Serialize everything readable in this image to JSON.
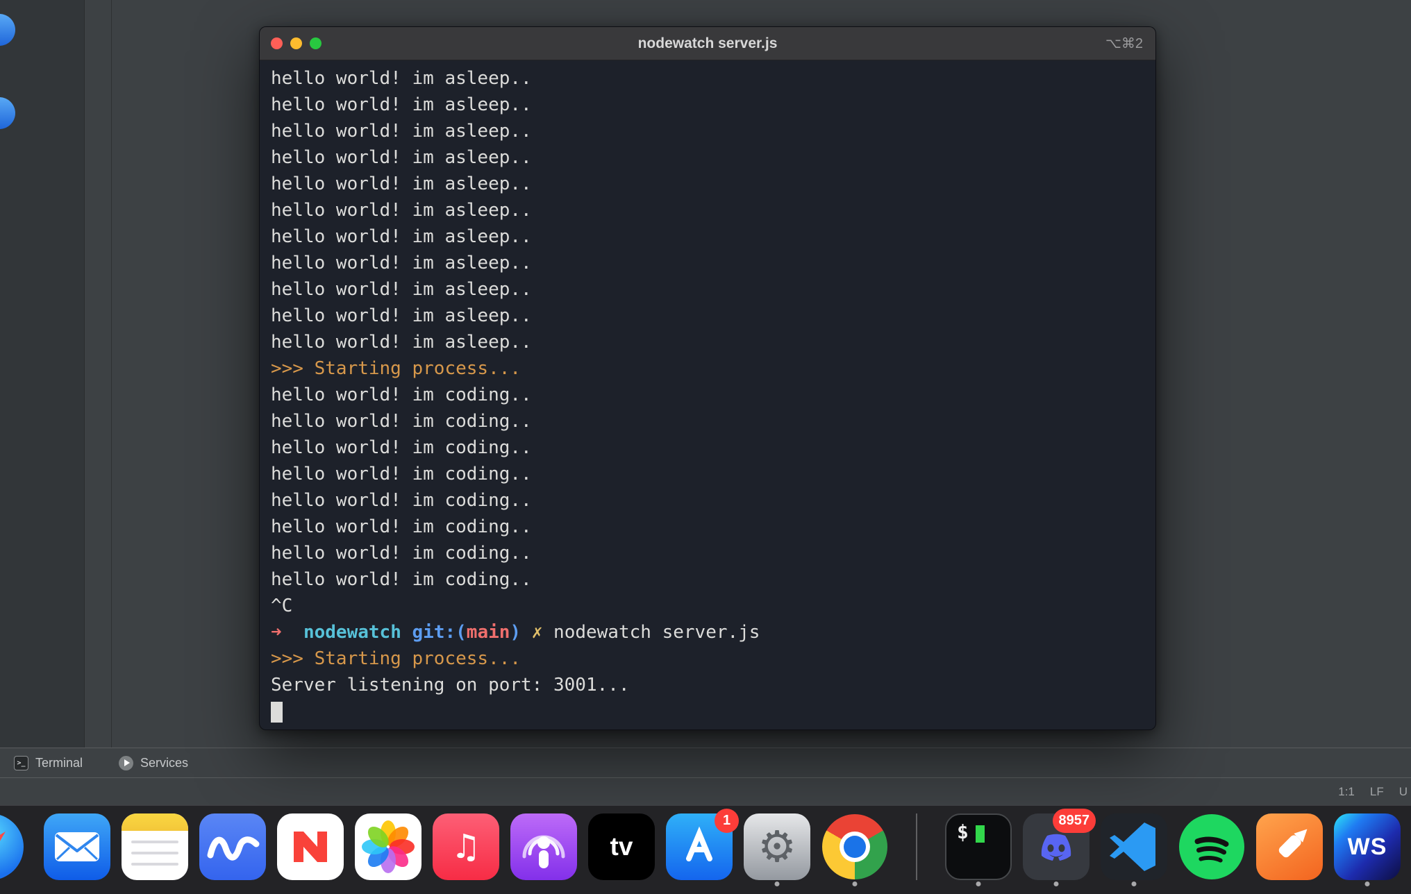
{
  "window": {
    "title": "nodewatch server.js",
    "shortcut": "⌥⌘2"
  },
  "terminal": {
    "colors": {
      "background": "#1d212a",
      "text": "#dcdcda",
      "accent": "#d7984b",
      "arrow": "#ef6f6d",
      "dir": "#57c1d8",
      "git": "#5d9df0",
      "branch": "#ef6f6d",
      "dirty": "#e2c06a"
    },
    "lines": [
      {
        "type": "plain",
        "text": "hello world! im asleep.."
      },
      {
        "type": "plain",
        "text": "hello world! im asleep.."
      },
      {
        "type": "plain",
        "text": "hello world! im asleep.."
      },
      {
        "type": "plain",
        "text": "hello world! im asleep.."
      },
      {
        "type": "plain",
        "text": "hello world! im asleep.."
      },
      {
        "type": "plain",
        "text": "hello world! im asleep.."
      },
      {
        "type": "plain",
        "text": "hello world! im asleep.."
      },
      {
        "type": "plain",
        "text": "hello world! im asleep.."
      },
      {
        "type": "plain",
        "text": "hello world! im asleep.."
      },
      {
        "type": "plain",
        "text": "hello world! im asleep.."
      },
      {
        "type": "plain",
        "text": "hello world! im asleep.."
      },
      {
        "type": "accent",
        "text": ">>> Starting process..."
      },
      {
        "type": "plain",
        "text": "hello world! im coding.."
      },
      {
        "type": "plain",
        "text": "hello world! im coding.."
      },
      {
        "type": "plain",
        "text": "hello world! im coding.."
      },
      {
        "type": "plain",
        "text": "hello world! im coding.."
      },
      {
        "type": "plain",
        "text": "hello world! im coding.."
      },
      {
        "type": "plain",
        "text": "hello world! im coding.."
      },
      {
        "type": "plain",
        "text": "hello world! im coding.."
      },
      {
        "type": "plain",
        "text": "hello world! im coding.."
      },
      {
        "type": "plain",
        "text": "^C"
      },
      {
        "type": "prompt",
        "segments": [
          {
            "class": "arrow",
            "text": "➜"
          },
          {
            "class": "plain",
            "text": "  "
          },
          {
            "class": "dir",
            "text": "nodewatch"
          },
          {
            "class": "plain",
            "text": " "
          },
          {
            "class": "git",
            "text": "git:("
          },
          {
            "class": "branch",
            "text": "main"
          },
          {
            "class": "git",
            "text": ")"
          },
          {
            "class": "plain",
            "text": " "
          },
          {
            "class": "dirty",
            "text": "✗"
          },
          {
            "class": "plain",
            "text": " nodewatch server.js"
          }
        ]
      },
      {
        "type": "accent",
        "text": ">>> Starting process..."
      },
      {
        "type": "plain",
        "text": "Server listening on port: 3001..."
      },
      {
        "type": "cursor"
      }
    ]
  },
  "ide": {
    "tabs": [
      {
        "label": "Terminal"
      },
      {
        "label": "Services"
      }
    ],
    "icons": {
      "terminal_tab_glyph": ">_"
    },
    "status": {
      "caret": "1:1",
      "line_ending": "LF",
      "encoding": "U"
    }
  },
  "dock": {
    "badge_color": "#fc3d39",
    "badges": {
      "app_store": "1",
      "discord": "8957"
    },
    "glyphs": {
      "apple_tv": "tv",
      "settings": "⚙",
      "music": "♫",
      "terminal_prompt": "$",
      "webstorm": "WS"
    },
    "icons": [
      {
        "name": "safari",
        "partial": true
      },
      {
        "name": "mail"
      },
      {
        "name": "notes"
      },
      {
        "name": "notability"
      },
      {
        "name": "news"
      },
      {
        "name": "photos"
      },
      {
        "name": "music"
      },
      {
        "name": "podcasts"
      },
      {
        "name": "apple-tv"
      },
      {
        "name": "app-store",
        "badge": "1"
      },
      {
        "name": "system-settings",
        "running": true
      },
      {
        "name": "chrome",
        "running": true
      },
      {
        "name": "terminal",
        "running": true
      },
      {
        "name": "discord",
        "badge": "8957",
        "running": true
      },
      {
        "name": "vscode",
        "running": true
      },
      {
        "name": "spotify"
      },
      {
        "name": "paw"
      },
      {
        "name": "webstorm",
        "running": true
      }
    ]
  }
}
